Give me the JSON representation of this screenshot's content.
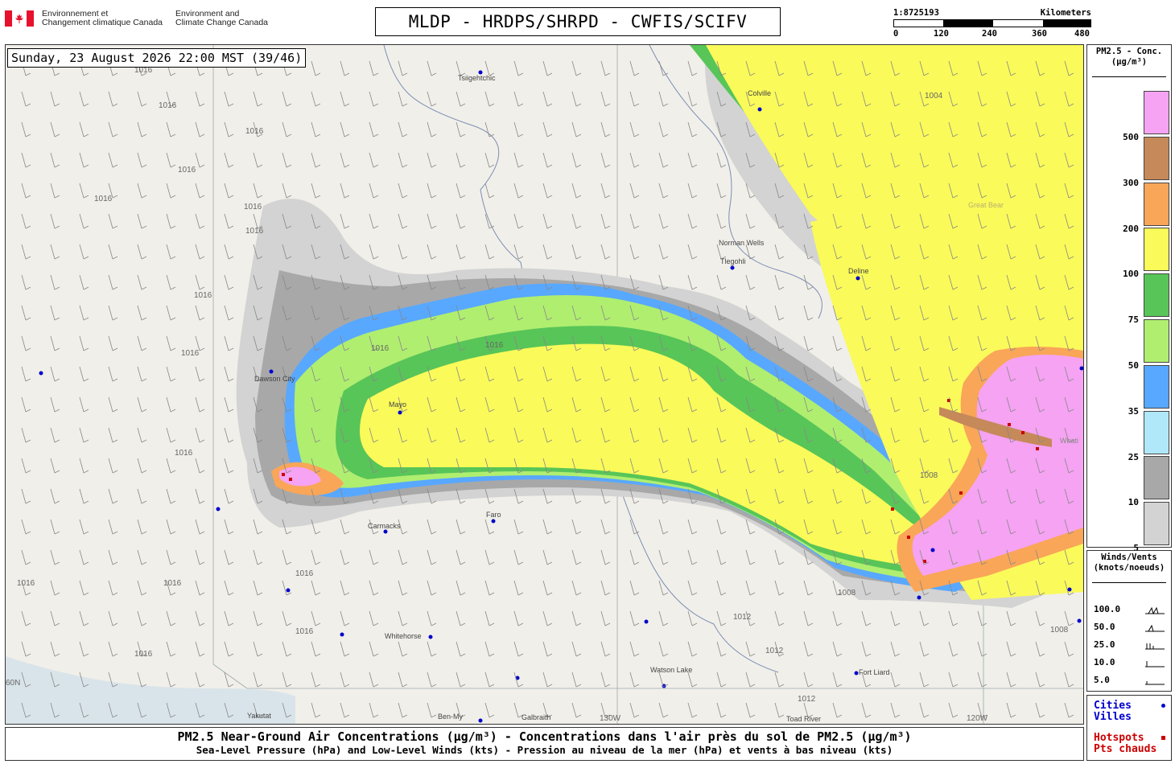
{
  "header": {
    "dept_fr": [
      "Environnement et",
      "Changement climatique Canada"
    ],
    "dept_en": [
      "Environment and",
      "Climate Change Canada"
    ],
    "title": "MLDP - HRDPS/SHRPD - CWFIS/SCIFV"
  },
  "scale": {
    "ratio": "1:8725193",
    "unit": "Kilometers",
    "ticks": [
      "0",
      "120",
      "240",
      "360",
      "480"
    ]
  },
  "map": {
    "date": "Sunday, 23 August 2026 22:00 MST (39/46)",
    "cities": [
      "Tsiigehtchic",
      "Colville",
      "Norman Wells",
      "Tlegohli",
      "Deline",
      "Great Bear",
      "Dawson City",
      "Mayo",
      "Faro",
      "Carmacks",
      "Whitehorse",
      "Watson Lake",
      "Fort Liard",
      "Yakutat",
      "Ben-My",
      "Galbraith",
      "Toad River",
      "Whati"
    ],
    "grid_labels": [
      "60N",
      "130W",
      "120W"
    ],
    "isobars": [
      "1016",
      "1016",
      "1016",
      "1016",
      "1016",
      "1016",
      "1016",
      "1016",
      "1016",
      "1016",
      "1016",
      "1016",
      "1016",
      "1016",
      "1016",
      "1016",
      "1016",
      "1004",
      "1008",
      "1008",
      "1008",
      "1012",
      "1012",
      "1012"
    ]
  },
  "legend_conc": {
    "title": [
      "PM2.5 - Conc.",
      "(µg/m³)"
    ],
    "levels": [
      {
        "label": "500",
        "color": "#f5a3f2"
      },
      {
        "label": "300",
        "color": "#c6895a"
      },
      {
        "label": "200",
        "color": "#f9a658"
      },
      {
        "label": "100",
        "color": "#fafa5a"
      },
      {
        "label": "75",
        "color": "#58c558"
      },
      {
        "label": "50",
        "color": "#b0ee70"
      },
      {
        "label": "35",
        "color": "#58a8ff"
      },
      {
        "label": "25",
        "color": "#b0e8fa"
      },
      {
        "label": "10",
        "color": "#a8a8a8"
      },
      {
        "label": "5",
        "color": "#d3d3d3"
      }
    ]
  },
  "legend_wind": {
    "title": [
      "Winds/Vents",
      "(knots/noeuds)"
    ],
    "rows": [
      "100.0",
      "50.0",
      "25.0",
      "10.0",
      "5.0"
    ]
  },
  "legend_cities": {
    "cities": [
      "Cities",
      "Villes"
    ],
    "hotspots": [
      "Hotspots",
      "Pts chauds"
    ],
    "city_color": "#0000cc",
    "hotspot_color": "#cc0000"
  },
  "footer": {
    "line1": "PM2.5 Near-Ground Air Concentrations (µg/m³) - Concentrations dans l'air près du sol de PM2.5 (µg/m³)",
    "line2": "Sea-Level Pressure (hPa) and Low-Level Winds (kts) - Pression au niveau de la mer (hPa) et vents à bas niveau (kts)"
  }
}
